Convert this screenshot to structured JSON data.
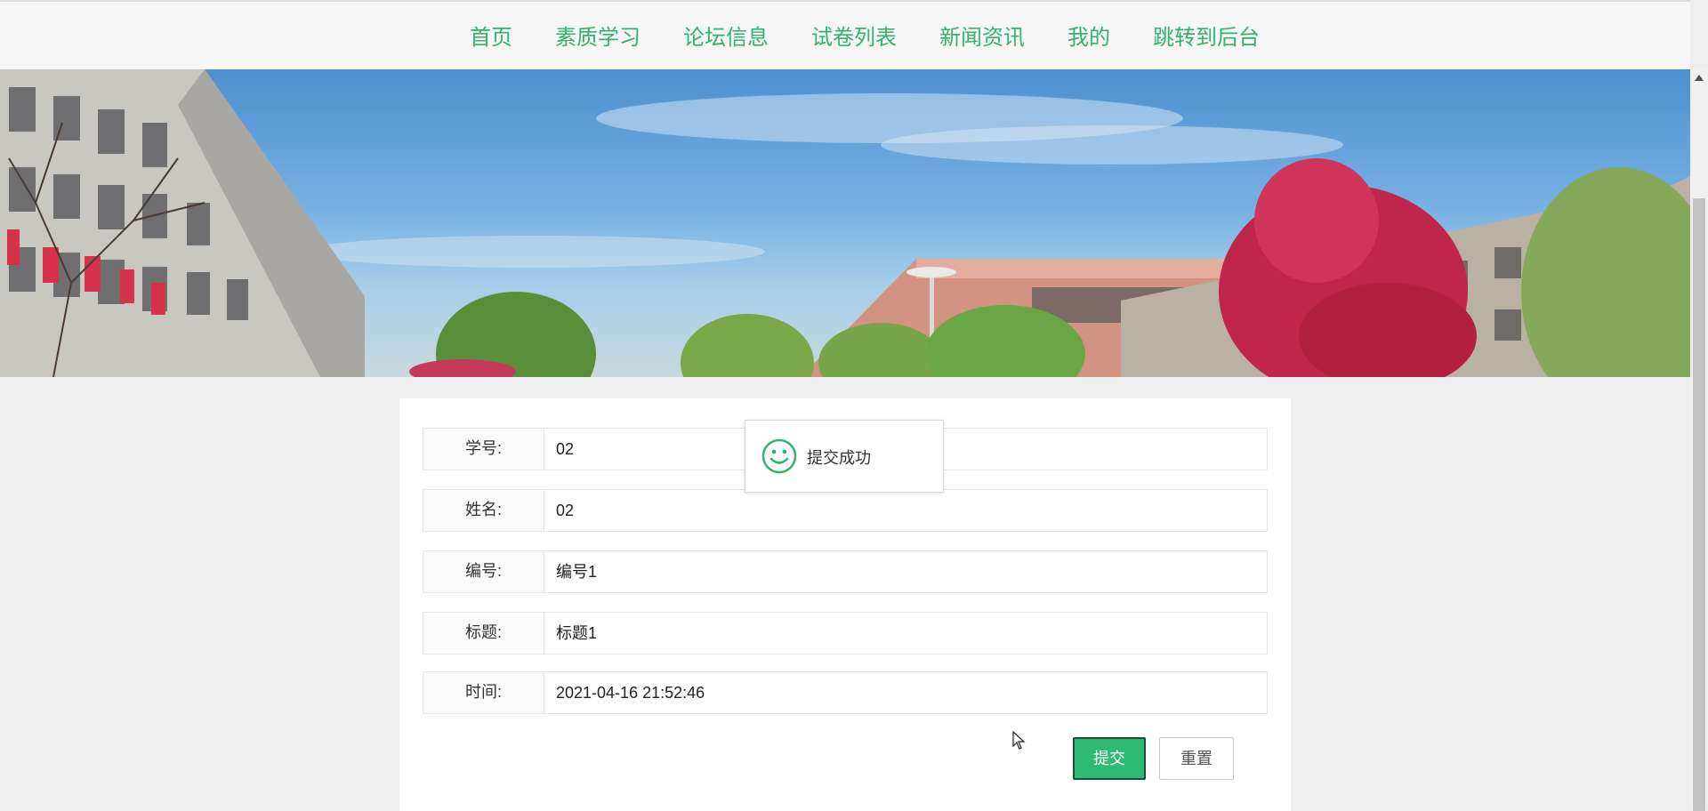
{
  "nav": {
    "items": [
      {
        "label": "首页"
      },
      {
        "label": "素质学习"
      },
      {
        "label": "论坛信息"
      },
      {
        "label": "试卷列表"
      },
      {
        "label": "新闻资讯"
      },
      {
        "label": "我的"
      },
      {
        "label": "跳转到后台"
      }
    ],
    "accent_color": "#32b36a"
  },
  "form": {
    "fields": [
      {
        "label": "学号:",
        "value": "02"
      },
      {
        "label": "姓名:",
        "value": "02"
      },
      {
        "label": "编号:",
        "value": "编号1"
      },
      {
        "label": "标题:",
        "value": "标题1"
      },
      {
        "label": "时间:",
        "value": "2021-04-16 21:52:46"
      }
    ],
    "submit_label": "提交",
    "reset_label": "重置",
    "submit_color": "#2fba74"
  },
  "toast": {
    "icon": "smile-icon",
    "message": "提交成功"
  }
}
